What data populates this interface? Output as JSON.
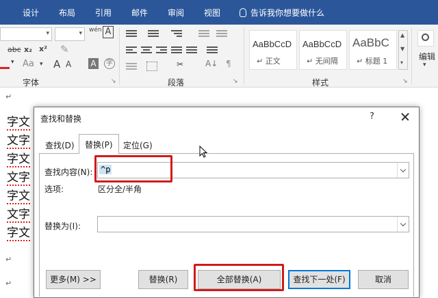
{
  "menu": {
    "tabs": [
      "设计",
      "布局",
      "引用",
      "邮件",
      "审阅",
      "视图"
    ],
    "tell_me": "告诉我你想要做什么"
  },
  "ribbon": {
    "font_group_label": "字体",
    "paragraph_group_label": "段落",
    "styles_group_label": "样式",
    "edit_label": "编辑",
    "font_small": [
      "abc",
      "x₂",
      "x²"
    ],
    "font_aa": "Aa",
    "font_a_large": "A",
    "font_a_small": "A",
    "font_a_box": "A",
    "wen": "wén",
    "styles": [
      {
        "sample": "AaBbCcD",
        "name": "正文"
      },
      {
        "sample": "AaBbCcD",
        "name": "无间隔"
      },
      {
        "sample": "AaBbC",
        "name": "标题 1"
      }
    ],
    "colors": {
      "ribbon_bg": "#f3f3f3",
      "title_bar": "#2b579a",
      "font_color_underline": "#e02020"
    }
  },
  "document": {
    "lines": [
      "字文",
      "文字",
      "字文",
      "文字",
      "字文",
      "文字",
      "字文"
    ],
    "para_mark": "↵"
  },
  "dialog": {
    "title": "查找和替换",
    "help": "?",
    "tabs": [
      "查找(D)",
      "替换(P)",
      "定位(G)"
    ],
    "active_tab": "替换(P)",
    "find_label": "查找内容(N):",
    "find_value": "^p",
    "options_label": "选项:",
    "options_value": "区分全/半角",
    "replace_label": "替换为(I):",
    "replace_value": "",
    "buttons": {
      "more": "更多(M) >>",
      "replace": "替换(R)",
      "replace_all": "全部替换(A)",
      "find_next": "查找下一处(F)",
      "cancel": "取消"
    },
    "highlight_color": "#d11a1a"
  }
}
